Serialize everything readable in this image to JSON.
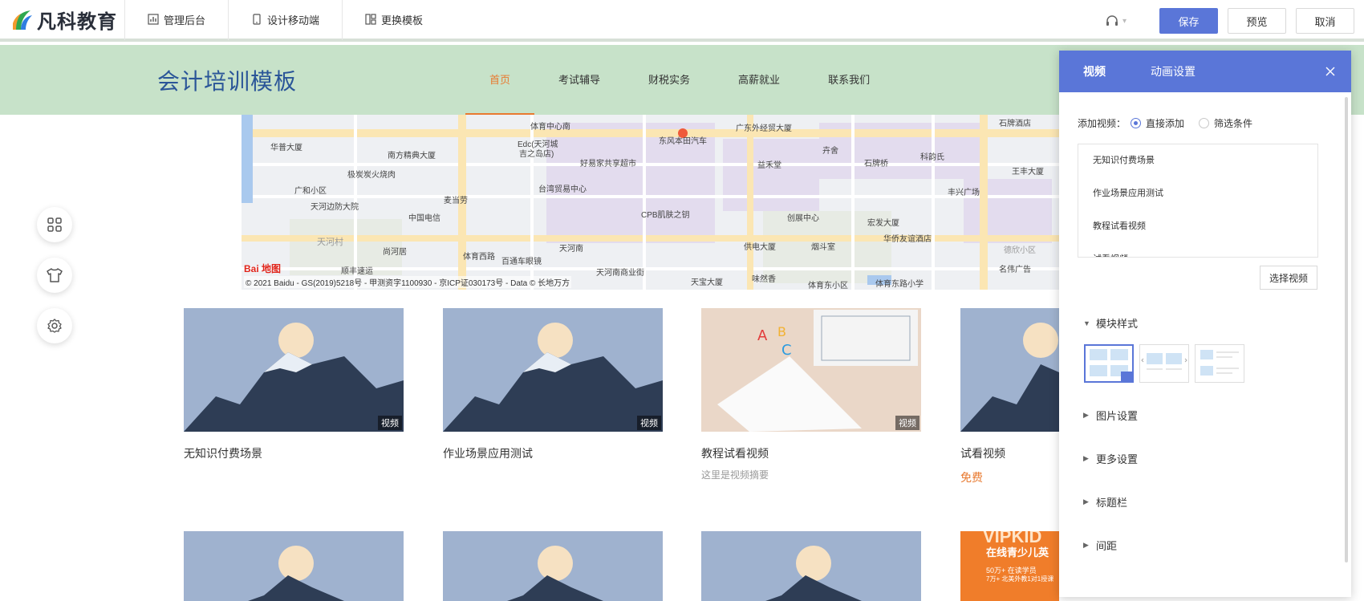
{
  "app": {
    "logo_text": "凡科教育",
    "toolbar": [
      {
        "label": "管理后台",
        "icon": "chart-icon"
      },
      {
        "label": "设计移动端",
        "icon": "phone-icon"
      },
      {
        "label": "更换模板",
        "icon": "template-icon"
      }
    ],
    "actions": {
      "save": "保存",
      "preview": "预览",
      "cancel": "取消"
    },
    "accent_color": "#5a76d8"
  },
  "site": {
    "title": "会计培训模板",
    "nav": [
      "首页",
      "考试辅导",
      "财税实务",
      "高薪就业",
      "联系我们"
    ],
    "active_nav": 0,
    "header_color": "#c7e2c9",
    "nav_active_color": "#e87a30"
  },
  "map": {
    "baidu_logo": "Bai 地图",
    "copyright": "© 2021 Baidu - GS(2019)5218号 - 甲测资字1100930 - 京ICP证030173号 - Data © 长地万方",
    "labels": [
      "体育中心南",
      "广东外经贸大厦",
      "石牌酒店",
      "华普大厦",
      "南方精典大厦",
      "Edc(天河城",
      "吉之岛店)",
      "好易家共享超市",
      "东风本田汽车",
      "益禾堂",
      "卉舍",
      "石牌桥",
      "科韵氏",
      "王丰大厦",
      "极炭炭火烧肉",
      "广和小区",
      "麦当劳",
      "台湾贸易中心",
      "天河边防大院",
      "中国电信",
      "CPB肌肤之钥",
      "创展中心",
      "宏发大厦",
      "丰兴广场",
      "天河村",
      "尚河居",
      "体育西路",
      "天河南",
      "供电大厦",
      "烟斗室",
      "华侨友谊酒店",
      "德欣小区",
      "顺丰速运",
      "百通车眼镜",
      "天河南商业街",
      "天宝大厦",
      "味然香",
      "体育东小区",
      "体育东路小学",
      "名伟广告"
    ]
  },
  "cards_row1": [
    {
      "title": "无知识付费场景",
      "badge": "视频",
      "summary": "",
      "price": ""
    },
    {
      "title": "作业场景应用测试",
      "badge": "视频",
      "summary": "",
      "price": ""
    },
    {
      "title": "教程试看视频",
      "badge": "视频",
      "summary": "这里是视频摘要",
      "price": ""
    },
    {
      "title": "试看视频",
      "badge": "",
      "summary": "",
      "price": "免费"
    }
  ],
  "cards_row2": [
    {
      "title": "",
      "badge": "",
      "summary": "",
      "price": ""
    },
    {
      "title": "",
      "badge": "",
      "summary": "",
      "price": ""
    },
    {
      "title": "",
      "badge": "",
      "summary": "",
      "price": ""
    },
    {
      "title": "",
      "badge": "",
      "summary": "",
      "price": "",
      "ad_line1": "VIPKID",
      "ad_line2": "在线青少儿英",
      "ad_line3": "50万+ 在读学员",
      "ad_line4": "7万+ 北美外教1对1授课"
    }
  ],
  "panel": {
    "tabs": [
      "视频",
      "动画设置"
    ],
    "active_tab": 0,
    "add_label": "添加视频：",
    "options": [
      "直接添加",
      "筛选条件"
    ],
    "selected_option": 0,
    "videos": [
      "无知识付费场景",
      "作业场景应用测试",
      "教程试看视频",
      "试看视频"
    ],
    "pick_button": "选择视频",
    "sections": [
      {
        "label": "模块样式",
        "expanded": true
      },
      {
        "label": "图片设置",
        "expanded": false
      },
      {
        "label": "更多设置",
        "expanded": false
      },
      {
        "label": "标题栏",
        "expanded": false
      },
      {
        "label": "间距",
        "expanded": false
      }
    ],
    "selected_style": 0
  }
}
